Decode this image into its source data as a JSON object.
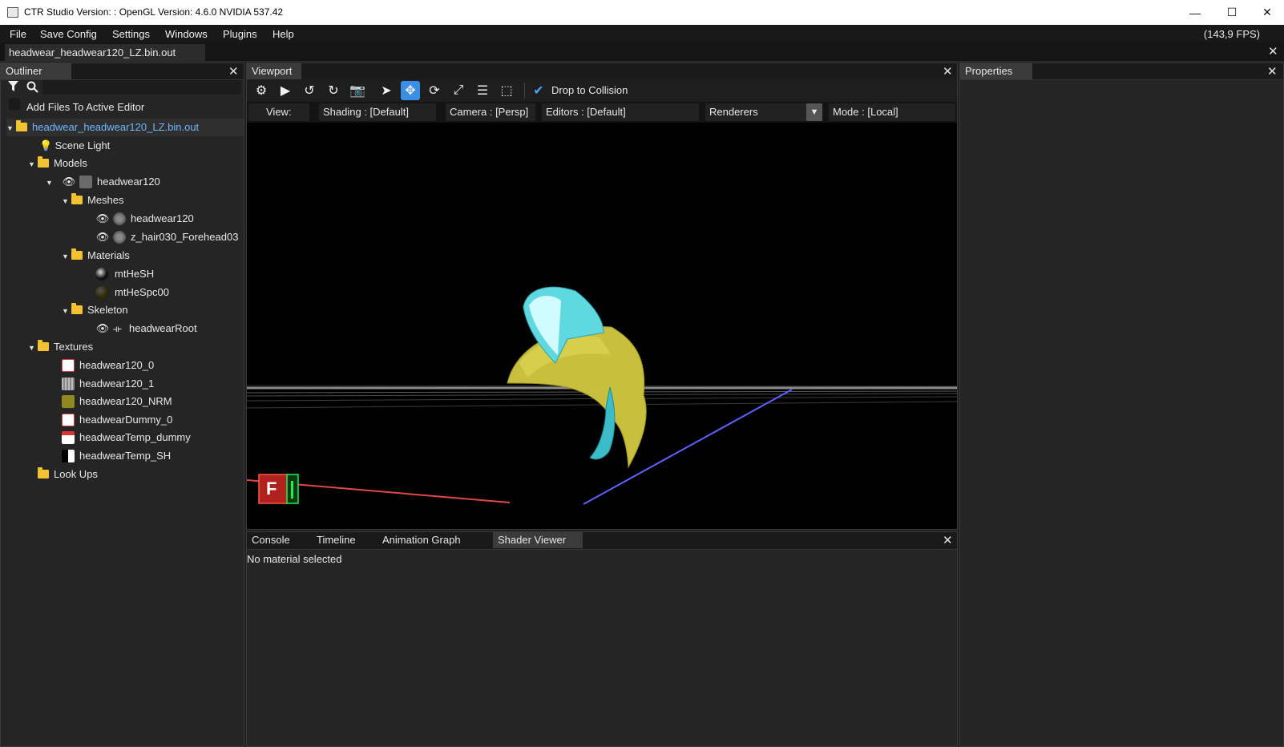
{
  "window": {
    "title": "CTR Studio Version: : OpenGL Version: 4.6.0 NVIDIA 537.42",
    "minimize": "—",
    "maximize": "☐",
    "close": "✕"
  },
  "menu": {
    "items": [
      "File",
      "Save Config",
      "Settings",
      "Windows",
      "Plugins",
      "Help"
    ],
    "fps": "(143,9 FPS)"
  },
  "document_tab": {
    "label": "headwear_headwear120_LZ.bin.out"
  },
  "outliner": {
    "title": "Outliner",
    "add_files": "Add Files To Active Editor",
    "tree": {
      "root": "headwear_headwear120_LZ.bin.out",
      "scene_light": "Scene Light",
      "models": "Models",
      "model": "headwear120",
      "meshes": "Meshes",
      "mesh_items": [
        "headwear120",
        "z_hair030_Forehead03"
      ],
      "materials": "Materials",
      "material_items": [
        "mtHeSH",
        "mtHeSpc00"
      ],
      "skeleton": "Skeleton",
      "bone": "headwearRoot",
      "textures": "Textures",
      "texture_items": [
        "headwear120_0",
        "headwear120_1",
        "headwear120_NRM",
        "headwearDummy_0",
        "headwearTemp_dummy",
        "headwearTemp_SH"
      ],
      "lookups": "Look Ups"
    }
  },
  "viewport": {
    "title": "Viewport",
    "drop_to_collision": "Drop to Collision",
    "view_label": "View:",
    "shading": "Shading : [Default]",
    "camera": "Camera : [Persp]",
    "editors": "Editors : [Default]",
    "renderers": "Renderers",
    "mode": "Mode : [Local]",
    "logo_letter": "F"
  },
  "properties": {
    "title": "Properties"
  },
  "bottom": {
    "tabs": [
      "Console",
      "Timeline",
      "Animation Graph",
      "Shader Viewer"
    ],
    "active_tab": "Shader Viewer",
    "message": "No material selected"
  },
  "colors": {
    "accent": "#4aa3ff",
    "root_text": "#6fb6ff",
    "folder": "#f2c230",
    "model_yellow": "#c9bf3e",
    "hair_cyan": "#5fd8e0",
    "axis_x": "#e04848",
    "axis_z": "#6060ff"
  }
}
